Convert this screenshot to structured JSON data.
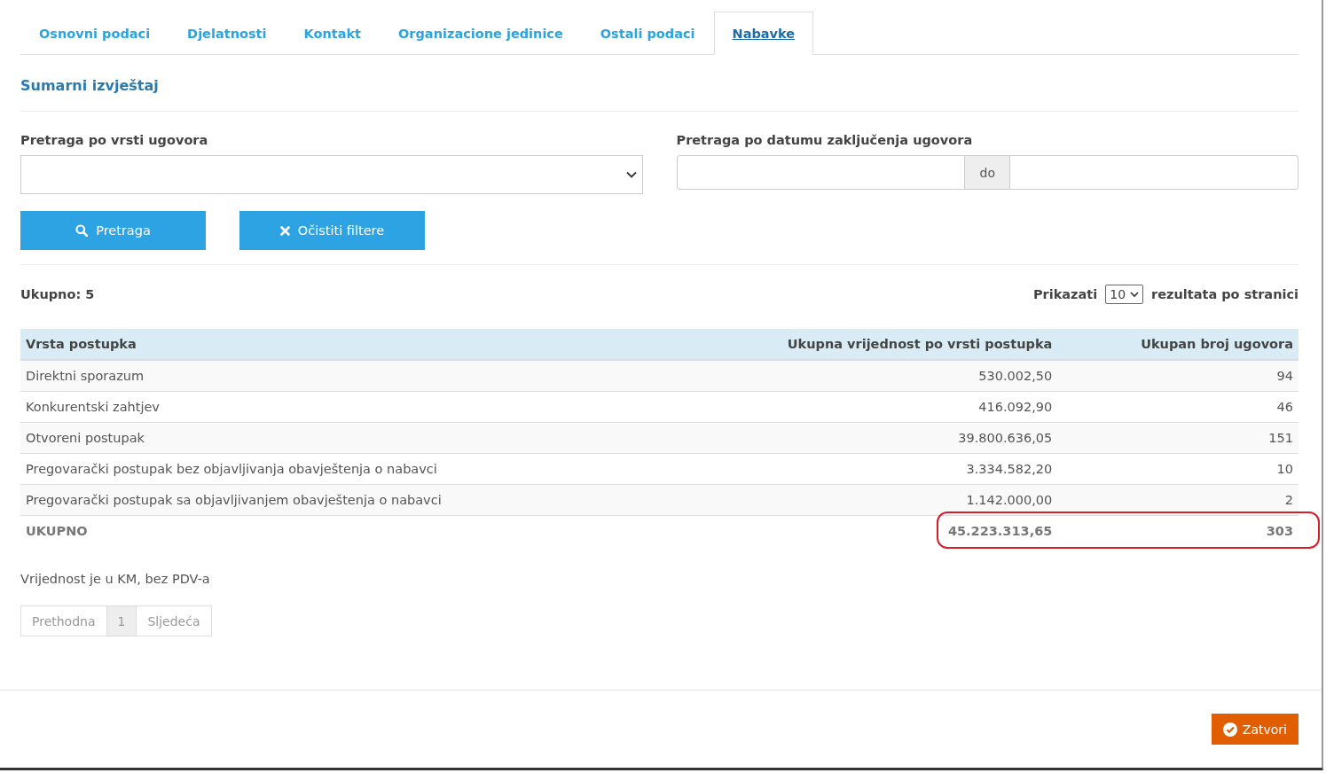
{
  "tabs": [
    {
      "label": "Osnovni podaci",
      "selected": false
    },
    {
      "label": "Djelatnosti",
      "selected": false
    },
    {
      "label": "Kontakt",
      "selected": false
    },
    {
      "label": "Organizacione jedinice",
      "selected": false
    },
    {
      "label": "Ostali podaci",
      "selected": false
    },
    {
      "label": "Nabavke",
      "selected": true
    }
  ],
  "section_title": "Sumarni izvještaj",
  "filters": {
    "contract_type": {
      "label": "Pretraga po vrsti ugovora"
    },
    "date_range": {
      "label": "Pretraga po datumu zaključenja ugovora",
      "separator": "do"
    }
  },
  "buttons": [
    {
      "kind": "search",
      "label": "Pretraga"
    },
    {
      "kind": "clear",
      "label": "Očistiti filtere"
    }
  ],
  "total_count": "Ukupno: 5",
  "page_size": {
    "before": "Prikazati",
    "value": "10",
    "after": "rezultata po stranici"
  },
  "table": {
    "columns": [
      "Vrsta postupka",
      "Ukupna vrijednost po vrsti postupka",
      "Ukupan broj ugovora"
    ],
    "rows": [
      [
        "Direktni sporazum",
        "530.002,50",
        "94"
      ],
      [
        "Konkurentski zahtjev",
        "416.092,90",
        "46"
      ],
      [
        "Otvoreni postupak",
        "39.800.636,05",
        "151"
      ],
      [
        "Pregovarački postupak bez objavljivanja obavještenja o nabavci",
        "3.334.582,20",
        "10"
      ],
      [
        "Pregovarački postupak sa objavljivanjem obavještenja o nabavci",
        "1.142.000,00",
        "2"
      ]
    ],
    "total": {
      "cells": [
        "UKUPNO",
        "45.223.313,65",
        "303"
      ],
      "highlighted": true
    }
  },
  "note": "Vrijednost je u KM, bez PDV-a",
  "pagination": [
    {
      "label": "Prethodna",
      "disabled": true,
      "selected": false
    },
    {
      "label": "1",
      "disabled": false,
      "selected": true
    },
    {
      "label": "Sljedeća",
      "disabled": true,
      "selected": false
    }
  ],
  "close_button": "Zatvori"
}
